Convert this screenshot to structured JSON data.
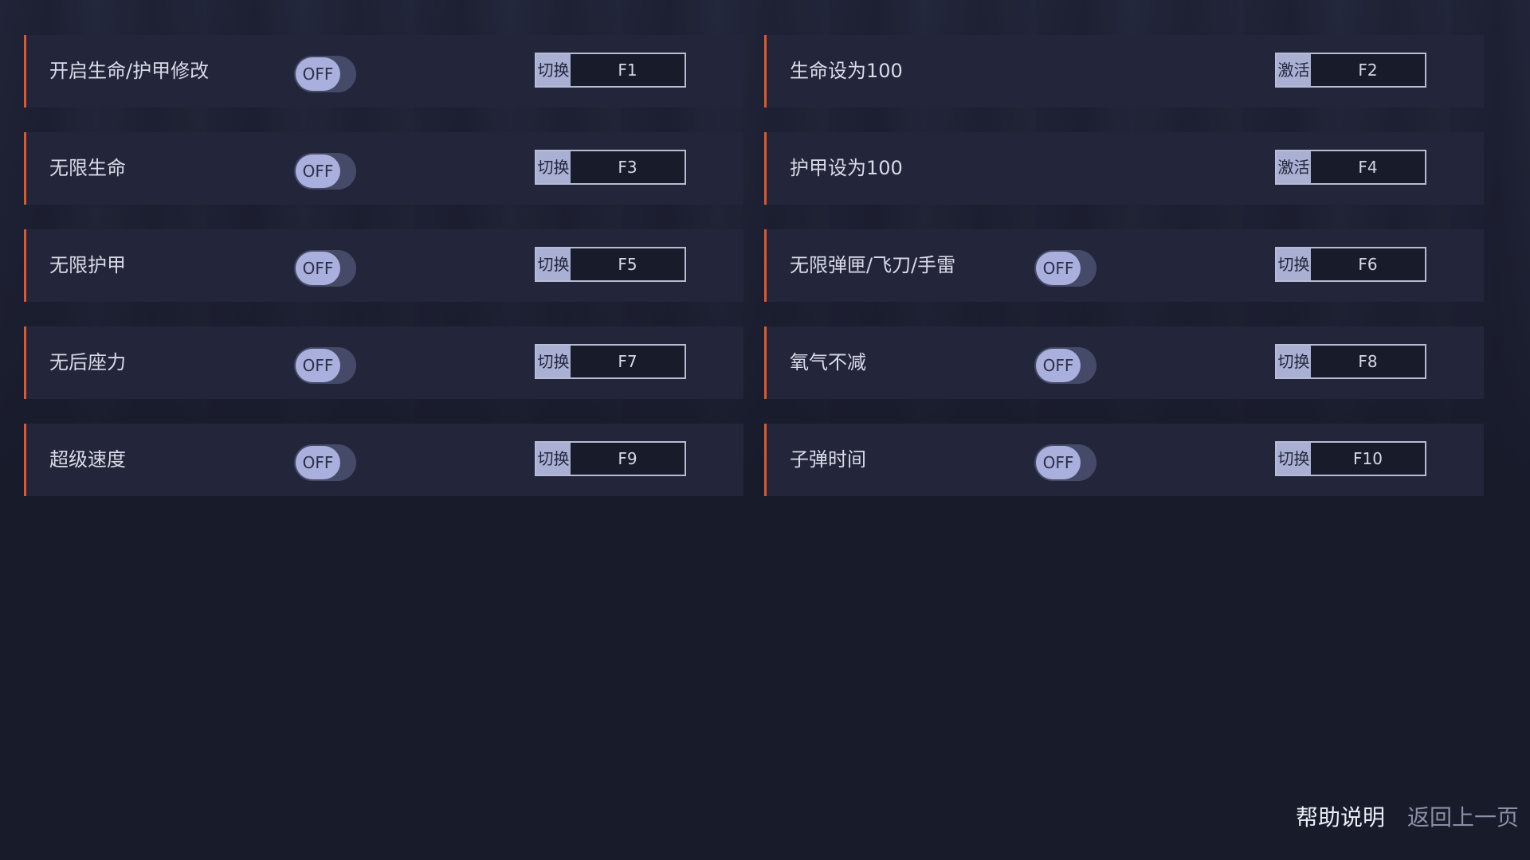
{
  "rows": [
    [
      {
        "label": "开启生命/护甲修改",
        "has_toggle": true,
        "toggle": "OFF",
        "mode": "切换",
        "key": "F1"
      },
      {
        "label": "生命设为100",
        "has_toggle": false,
        "toggle": "",
        "mode": "激活",
        "key": "F2"
      }
    ],
    [
      {
        "label": "无限生命",
        "has_toggle": true,
        "toggle": "OFF",
        "mode": "切换",
        "key": "F3"
      },
      {
        "label": "护甲设为100",
        "has_toggle": false,
        "toggle": "",
        "mode": "激活",
        "key": "F4"
      }
    ],
    [
      {
        "label": "无限护甲",
        "has_toggle": true,
        "toggle": "OFF",
        "mode": "切换",
        "key": "F5"
      },
      {
        "label": "无限弹匣/飞刀/手雷",
        "has_toggle": true,
        "toggle": "OFF",
        "mode": "切换",
        "key": "F6"
      }
    ],
    [
      {
        "label": "无后座力",
        "has_toggle": true,
        "toggle": "OFF",
        "mode": "切换",
        "key": "F7"
      },
      {
        "label": "氧气不减",
        "has_toggle": true,
        "toggle": "OFF",
        "mode": "切换",
        "key": "F8"
      }
    ],
    [
      {
        "label": "超级速度",
        "has_toggle": true,
        "toggle": "OFF",
        "mode": "切换",
        "key": "F9"
      },
      {
        "label": "子弹时间",
        "has_toggle": true,
        "toggle": "OFF",
        "mode": "切换",
        "key": "F10"
      }
    ]
  ],
  "footer": {
    "help": "帮助说明",
    "back": "返回上一页"
  },
  "colors": {
    "accent": "#e2562b",
    "background": "#181b2a",
    "cell": "#23263a"
  }
}
